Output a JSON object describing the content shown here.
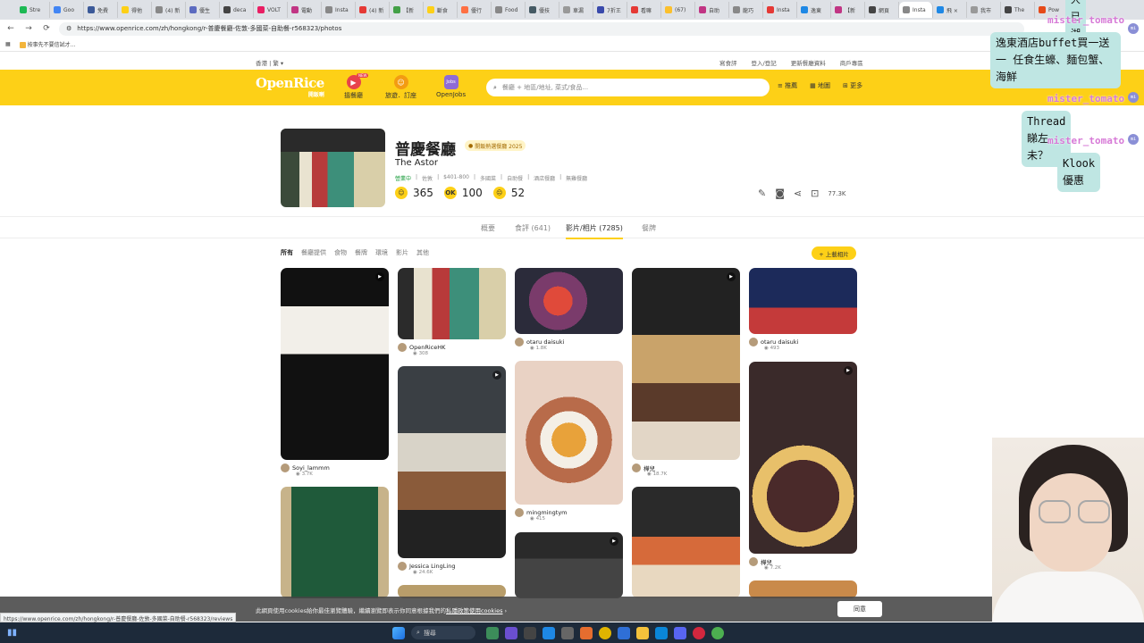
{
  "browser": {
    "tabs": [
      "Stre",
      "Goo",
      "免費",
      "得他",
      "(4) 新",
      "優生",
      "deca",
      "VOLT",
      "電動",
      "Insta",
      "(4) 新",
      "【新",
      "斷食",
      "優行",
      "Food",
      "優技",
      "車漏",
      "7折王",
      "看嘛",
      "(67)",
      "自助",
      "龍巧",
      "Insta",
      "逸東",
      "【新",
      "網頁",
      "Insta",
      "飛 ×",
      "我市",
      "The",
      "Pow"
    ],
    "url": "https://www.openrice.com/zh/hongkong/r-普慶餐廳-佐敦-多國菜-自助餐-r568323/photos",
    "bookmark": "按事先不要信試才..."
  },
  "site": {
    "region": "香港 | 繁 ▾",
    "top_links": [
      "寫食評",
      "登入/登記",
      "更新餐廳資料",
      "商戶專區"
    ],
    "logo": "OpenRice",
    "logo_sub": "開飯喇",
    "nav": [
      {
        "label": "搵餐廳",
        "icon": "▶",
        "color": "#e8434b",
        "badge": "NEW"
      },
      {
        "label": "旅遊．訂座",
        "icon": "☺",
        "color": "#f39c12"
      },
      {
        "label": "OpenJobs",
        "icon": "Jobs",
        "color": "#8e6bd6"
      }
    ],
    "search_placeholder": "餐廳 + 地區/地址, 菜式/食品...",
    "header_buttons": [
      "推薦",
      "地圖",
      "更多"
    ]
  },
  "restaurant": {
    "name": "普慶餐廳",
    "name_en": "The Astor",
    "badge": "開飯熱選餐廳 2025",
    "status": "營業中",
    "meta": [
      "佐敦",
      "$401-800",
      "多國菜",
      "自助餐",
      "酒店餐廳",
      "無雞餐廳"
    ],
    "smile": "365",
    "ok": "100",
    "cry": "52",
    "bookmarks": "77.3K"
  },
  "tabs": [
    "概要",
    "食評 (641)",
    "影片/相片 (7285)",
    "餐牌"
  ],
  "filters": [
    "所有",
    "餐廳提供",
    "食物",
    "餐牌",
    "環境",
    "影片",
    "其他"
  ],
  "upload_label": "+ 上載相片",
  "photos": [
    {
      "user": "Soyi_lammm",
      "views": "3.7K"
    },
    {
      "user": "OpenRiceHK",
      "views": "308"
    },
    {
      "user": "otaru daisuki",
      "views": "1.8K"
    },
    {
      "user": "樺兒",
      "views": "18.7K"
    },
    {
      "user": "otaru daisuki",
      "views": "493"
    },
    {
      "user": "Jessica LingLing",
      "views": "24.6K"
    },
    {
      "user": "mingmingtym",
      "views": "415"
    },
    {
      "user": "樺兒",
      "views": "7.2K"
    }
  ],
  "cookie": {
    "text": "此網頁使用cookies給你最佳瀏覽體驗，繼續瀏覽即表示你同意根據我們的",
    "link": "私隱政策使用cookies",
    "button": "同意"
  },
  "status_url": "https://www.openrice.com/zh/hongkong/r-普慶餐廳-佐敦-多國菜-自助餐-r568323/reviews",
  "taskbar": {
    "search": "搜尋"
  },
  "stream_chat": [
    {
      "name": "mister_tomato",
      "message": "逸東酒店buffet買一送一 任食生蠔、麵包蟹、海鮮"
    },
    {
      "name": "mister_tomato",
      "message": "Thread 睇左未？"
    },
    {
      "name": "mister_tomato",
      "message": "Klook優惠"
    }
  ],
  "chat_top_partial": "大已湖湖"
}
